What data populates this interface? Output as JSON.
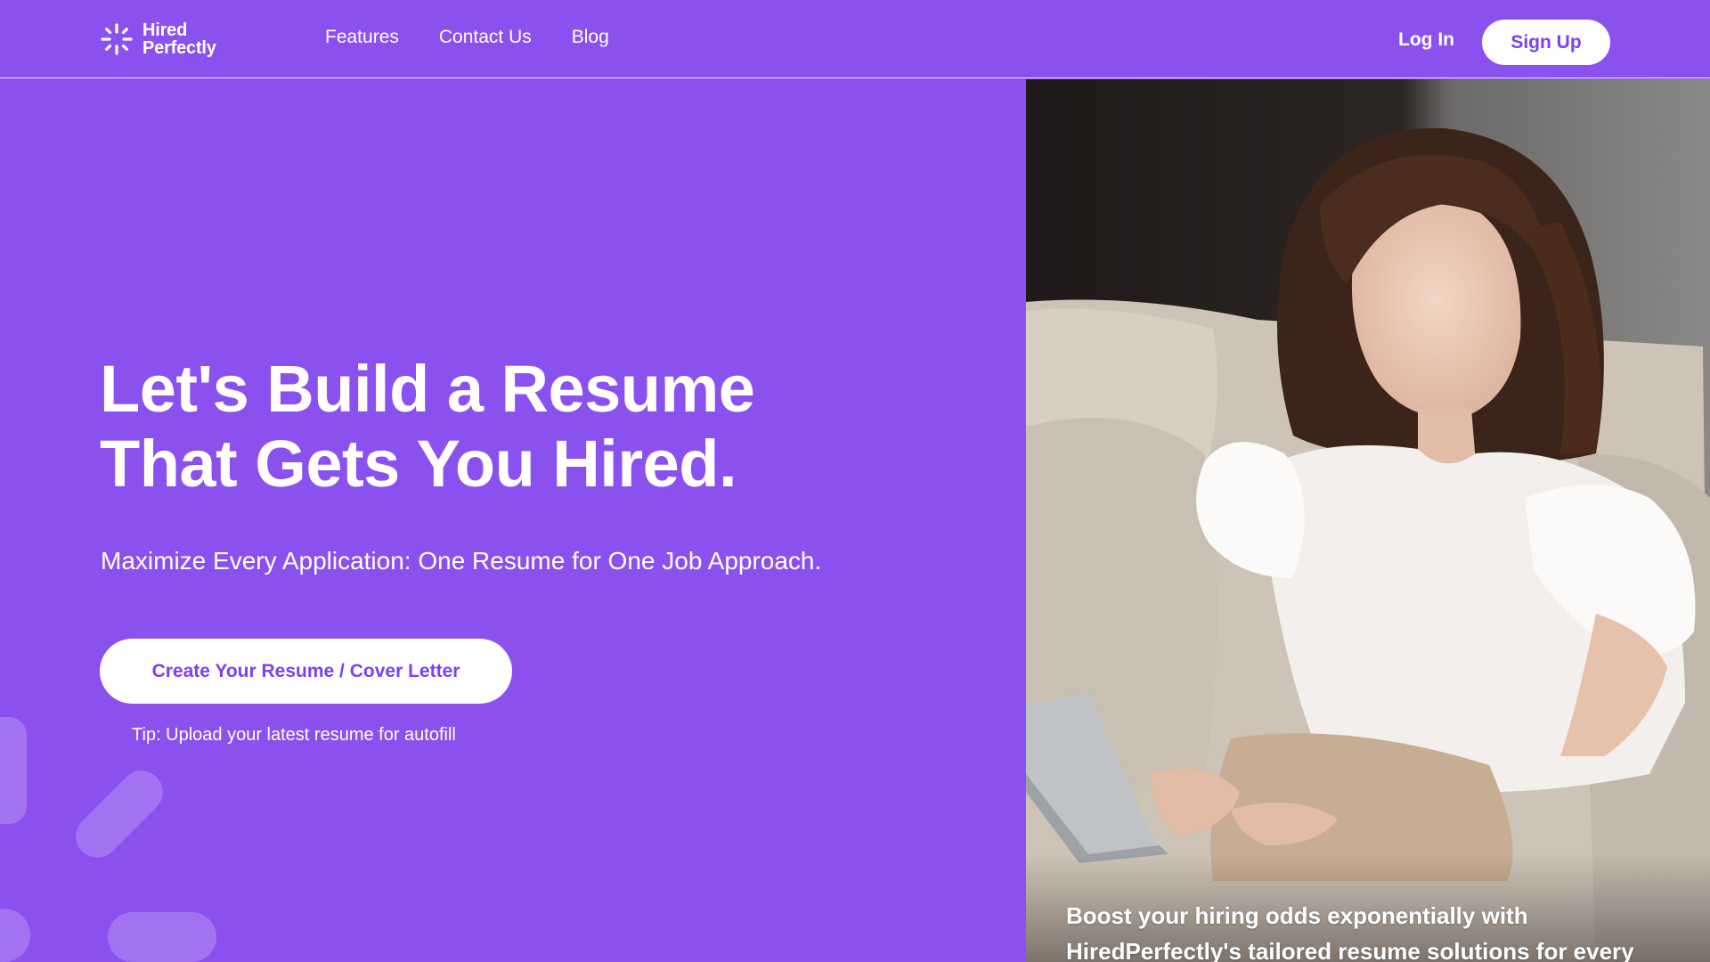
{
  "brand": {
    "name_line1": "Hired",
    "name_line2": "Perfectly",
    "logo_icon": "sparkle-burst-icon",
    "accent_color": "#8b51ee",
    "button_text_color": "#7d3ff0"
  },
  "nav": {
    "links": [
      "Features",
      "Contact Us",
      "Blog"
    ],
    "login_label": "Log In",
    "signup_label": "Sign Up"
  },
  "hero": {
    "title_line1": "Let's Build a Resume",
    "title_line2": "That Gets You Hired.",
    "subtitle": "Maximize Every Application: One Resume for One Job Approach.",
    "cta_label": "Create Your Resume / Cover Letter",
    "tip": "Tip: Upload your latest resume for autofill"
  },
  "photo": {
    "caption": "Boost your hiring odds exponentially with HiredPerfectly's tailored resume solutions for every"
  }
}
